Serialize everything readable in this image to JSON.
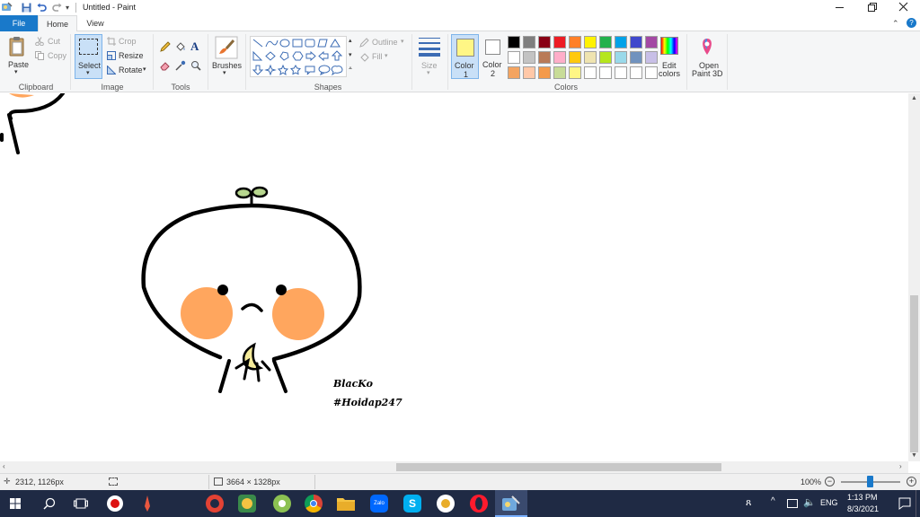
{
  "window": {
    "title": "Untitled - Paint",
    "minimize_icon": "minimize-icon",
    "maximize_icon": "restore-icon",
    "close_icon": "close-icon"
  },
  "tabs": [
    {
      "label": "File",
      "active": false,
      "accent": "#1979ca"
    },
    {
      "label": "Home",
      "active": true
    },
    {
      "label": "View",
      "active": false
    }
  ],
  "ribbon": {
    "clipboard": {
      "label": "Clipboard",
      "paste": "Paste",
      "cut": "Cut",
      "copy": "Copy"
    },
    "image": {
      "label": "Image",
      "select": "Select",
      "crop": "Crop",
      "resize": "Resize",
      "rotate": "Rotate"
    },
    "tools": {
      "label": "Tools"
    },
    "brushes": {
      "label": "Brushes"
    },
    "shapes": {
      "label": "Shapes",
      "outline": "Outline",
      "fill": "Fill"
    },
    "size": {
      "label": "Size"
    },
    "colors": {
      "label": "Colors",
      "color1_label": "Color",
      "color1_num": "1",
      "color1_value": "#fff685",
      "color2_label": "Color",
      "color2_num": "2",
      "color2_value": "#ffffff",
      "edit_colors_line1": "Edit",
      "edit_colors_line2": "colors",
      "open3d_line1": "Open",
      "open3d_line2": "Paint 3D",
      "palette_row1": [
        "#000000",
        "#7f7f7f",
        "#880015",
        "#ed1c24",
        "#ff7f27",
        "#fff200",
        "#22b14c",
        "#00a2e8",
        "#3f48cc",
        "#a349a4"
      ],
      "palette_row2": [
        "#ffffff",
        "#c3c3c3",
        "#b97a57",
        "#ffaec9",
        "#ffc90e",
        "#efe4b0",
        "#b5e61d",
        "#99d9ea",
        "#7092be",
        "#c8bfe7"
      ],
      "palette_row3": [
        "#f4a460",
        "#ffc8a8",
        "#f49a4a",
        "#c8dc98",
        "#fff685",
        "#ffffff",
        "#ffffff",
        "#ffffff",
        "#ffffff",
        "#ffffff"
      ]
    }
  },
  "canvas": {
    "signature_line1": "BlacKo",
    "signature_line2": "#Hoidap247",
    "colors": {
      "cheek": "#ffa65e",
      "sprout": "#b7d68e",
      "moon": "#f5eb9a",
      "stroke": "#000000"
    }
  },
  "status": {
    "cursor_pos": "2312, 1126px",
    "image_size": "3664 × 1328px",
    "zoom": "100%"
  },
  "taskbar": {
    "lang": "ENG",
    "time": "1:13 PM",
    "date": "8/3/2021",
    "apps": [
      "start-icon",
      "search-icon",
      "task-view-icon",
      "record-icon",
      "pencil-app-icon",
      "ccleaner-icon",
      "photos-app-icon",
      "greenshot-icon",
      "chrome-icon",
      "file-explorer-icon",
      "zalo-icon",
      "skype-icon",
      "chrome-canary-icon",
      "opera-icon",
      "paint-icon"
    ]
  }
}
